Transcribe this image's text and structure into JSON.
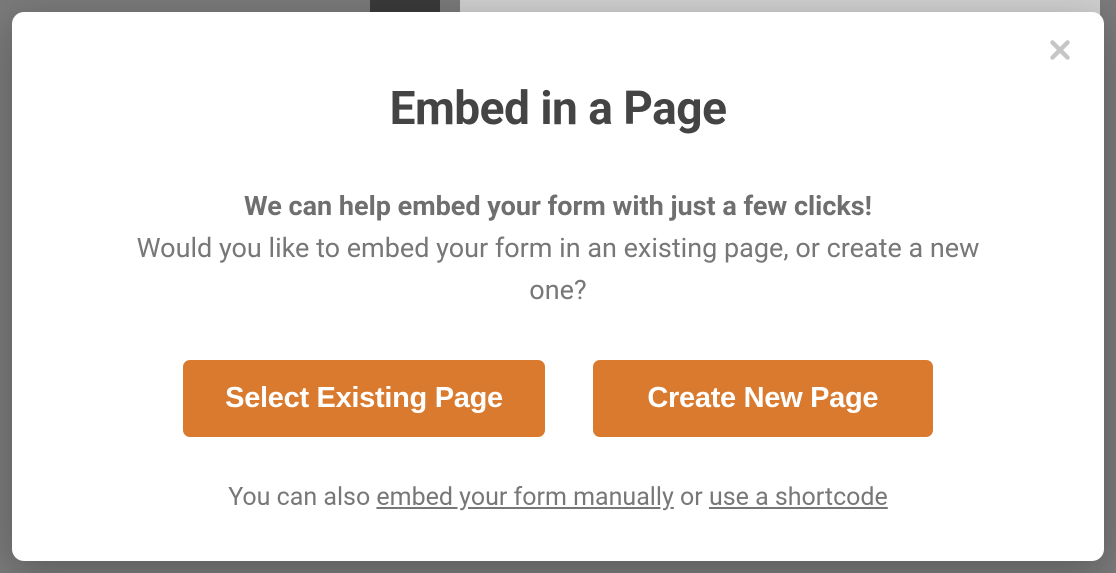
{
  "modal": {
    "title": "Embed in a Page",
    "subtitle_strong": "We can help embed your form with just a few clicks!",
    "subtitle_regular": "Would you like to embed your form in an existing page, or create a new one?",
    "buttons": {
      "select_existing": "Select Existing Page",
      "create_new": "Create New Page"
    },
    "footer": {
      "prefix": "You can also ",
      "link_embed": "embed your form manually",
      "mid": " or ",
      "link_shortcode": "use a shortcode"
    }
  }
}
